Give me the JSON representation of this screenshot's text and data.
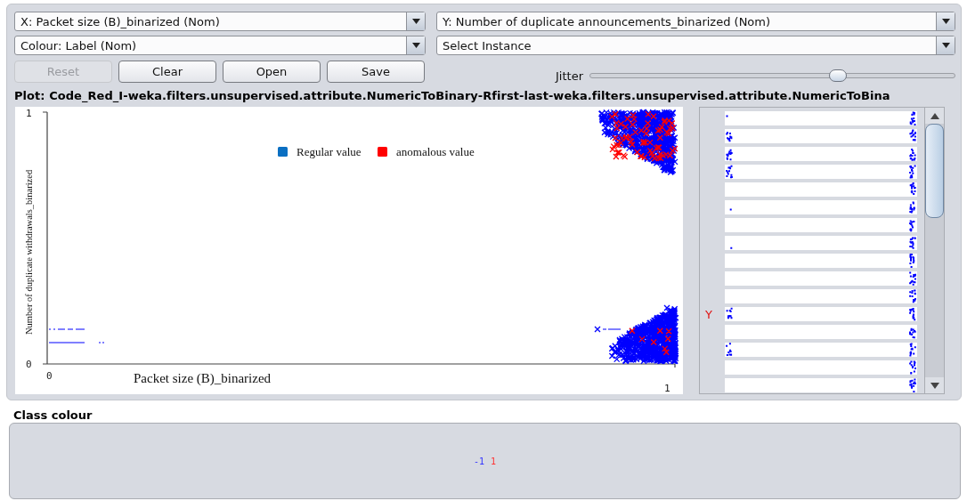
{
  "controls": {
    "x_select": "X: Packet size (B)_binarized (Nom)",
    "y_select": "Y: Number of duplicate announcements_binarized (Nom)",
    "colour_select": "Colour: Label (Nom)",
    "instance_select": "Select Instance"
  },
  "buttons": [
    {
      "label": "Reset",
      "disabled": true
    },
    {
      "label": "Clear",
      "disabled": false
    },
    {
      "label": "Open",
      "disabled": false
    },
    {
      "label": "Save",
      "disabled": false
    }
  ],
  "jitter": {
    "label": "Jitter",
    "level": 0.68
  },
  "plot": {
    "title": "Plot: Code_Red_I-weka.filters.unsupervised.attribute.NumericToBinary-Rfirst-last-weka.filters.unsupervised.attribute.NumericToBina",
    "x_axis_label": "Packet size (B)_binarized",
    "y_axis_label": "Number of duplicate withdrawals_binarized",
    "x_ticks": [
      "0",
      "1"
    ],
    "y_ticks": [
      "1",
      "0"
    ],
    "legend": [
      {
        "label": "Regular value",
        "color": "#0a6fc2"
      },
      {
        "label": "anomalous value",
        "color": "#ff0000"
      }
    ]
  },
  "attribute_panel": {
    "marker": "Y",
    "rows": [
      {
        "marked": false
      },
      {
        "marked": false
      },
      {
        "marked": false
      },
      {
        "marked": false
      },
      {
        "marked": false
      },
      {
        "marked": false
      },
      {
        "marked": false
      },
      {
        "marked": false
      },
      {
        "marked": false
      },
      {
        "marked": false
      },
      {
        "marked": false
      },
      {
        "marked": true
      },
      {
        "marked": false
      },
      {
        "marked": false
      },
      {
        "marked": false
      },
      {
        "marked": false
      }
    ]
  },
  "class_colour": {
    "title": "Class colour",
    "classes": [
      {
        "label": "-1",
        "color": "#3333ff"
      },
      {
        "label": "1",
        "color": "#ff3333"
      }
    ]
  }
}
